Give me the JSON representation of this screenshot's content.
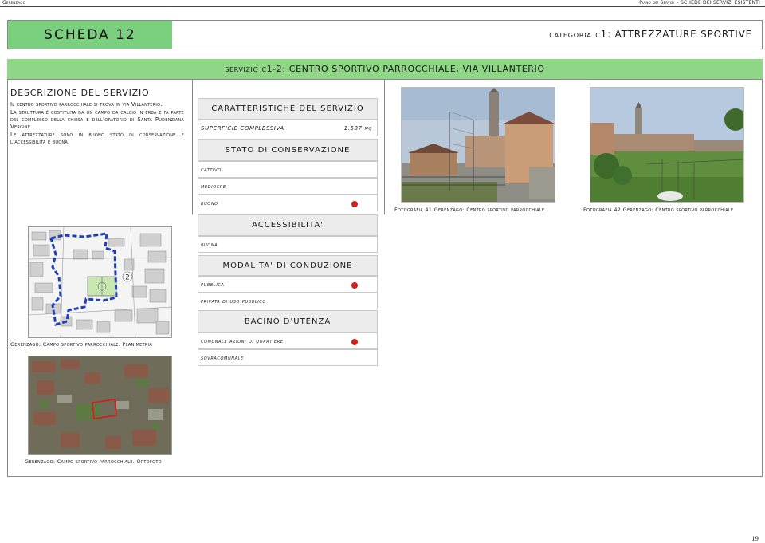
{
  "topbar": {
    "left": "Gerenzago",
    "right": "Piano dei Servizi – SCHEDE DEI SERVIZI ESISTENTI"
  },
  "header": {
    "scheda": "SCHEDA 12",
    "categoria": "categoria c1: ATTREZZATURE SPORTIVE"
  },
  "service_title": "servizio c1-2: CENTRO SPORTIVO PARROCCHIALE, VIA VILLANTERIO",
  "description": {
    "heading": "DESCRIZIONE DEL SERVIZIO",
    "paragraphs": [
      "Il centro sportivo parrocchiale si trova in via Villanterio.",
      "La struttura è costituita da un campo da calcio in erba e fa parte del complesso della chiesa e dell’oratorio di Santa Pudenziana Vergine.",
      "Le attrezzature sono in buono stato di conservazione e l’accessibilità è buona."
    ]
  },
  "maps": {
    "plan_number": "2",
    "plan_caption": "Gerenzago: Campo sportivo parrocchiale. Planimetria",
    "ortho_caption": "Gerenzago: Campo sportivo parrocchiale. Ortofoto"
  },
  "characteristics": {
    "title": "CARATTERISTICHE DEL SERVIZIO",
    "surface_label": "SUPERFICIE COMPLESSIVA",
    "surface_value": "1.537 mq"
  },
  "conservation": {
    "title": "STATO DI CONSERVAZIONE",
    "options": [
      "cattivo",
      "mediocre",
      "buono"
    ],
    "selected": "buono"
  },
  "accessibility": {
    "title": "ACCESSIBILITA'",
    "value": "buona"
  },
  "management": {
    "title": "MODALITA' DI CONDUZIONE",
    "options": [
      "pubblica",
      "privata di uso pubblico"
    ],
    "selected": "pubblica"
  },
  "catchment": {
    "title": "BACINO D'UTENZA",
    "options": [
      "comunale azioni di quartiere",
      "sovracomunale"
    ],
    "selected": "comunale azioni di quartiere"
  },
  "photos": [
    {
      "caption": "Fotografia 41 Gerenzago: Centro sportivo parrocchiale"
    },
    {
      "caption": "Fotografia 42 Gerenzago: Centro sportivo parrocchiale"
    }
  ],
  "page_number": "19",
  "colors": {
    "scheda_green": "#7bd07f",
    "title_green": "#8fd687",
    "selected_dot": "#d02020",
    "boundary_blue": "#1f3fb8",
    "ortho_red": "#e01818"
  }
}
